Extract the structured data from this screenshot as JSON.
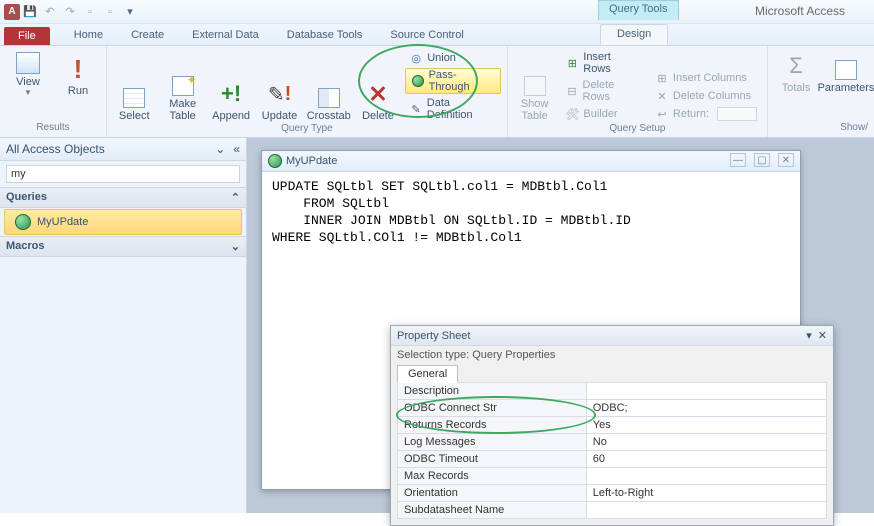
{
  "app_title": "Microsoft Access",
  "context_tab": "Query Tools",
  "tabs": {
    "file": "File",
    "home": "Home",
    "create": "Create",
    "external": "External Data",
    "dbtools": "Database Tools",
    "source": "Source Control",
    "design": "Design"
  },
  "ribbon": {
    "results": {
      "label": "Results",
      "view": "View",
      "run": "Run"
    },
    "querytype": {
      "label": "Query Type",
      "select": "Select",
      "maketable": "Make\nTable",
      "append": "Append",
      "update": "Update",
      "crosstab": "Crosstab",
      "delete": "Delete",
      "union": "Union",
      "passthrough": "Pass-Through",
      "datadef": "Data Definition"
    },
    "showtable": "Show\nTable",
    "setup": {
      "label": "Query Setup",
      "insrows": "Insert Rows",
      "delrows": "Delete Rows",
      "builder": "Builder",
      "inscols": "Insert Columns",
      "delcols": "Delete Columns",
      "return": "Return:"
    },
    "totals": "Totals",
    "params": "Parameters",
    "showhide": "Show/"
  },
  "nav": {
    "header": "All Access Objects",
    "search": "my",
    "g_queries": "Queries",
    "item1": "MyUPdate",
    "g_macros": "Macros"
  },
  "sqlwin_title": "MyUPdate",
  "sql": "UPDATE SQLtbl SET SQLtbl.col1 = MDBtbl.Col1\n    FROM SQLtbl\n    INNER JOIN MDBtbl ON SQLtbl.ID = MDBtbl.ID\nWHERE SQLtbl.COl1 != MDBtbl.Col1",
  "prop": {
    "title": "Property Sheet",
    "seltype_lbl": "Selection type:",
    "seltype_val": "Query Properties",
    "tab": "General",
    "rows": [
      [
        "Description",
        ""
      ],
      [
        "ODBC Connect Str",
        "ODBC;"
      ],
      [
        "Returns Records",
        "Yes"
      ],
      [
        "Log Messages",
        "No"
      ],
      [
        "ODBC Timeout",
        "60"
      ],
      [
        "Max Records",
        ""
      ],
      [
        "Orientation",
        "Left-to-Right"
      ],
      [
        "Subdatasheet Name",
        ""
      ]
    ]
  }
}
